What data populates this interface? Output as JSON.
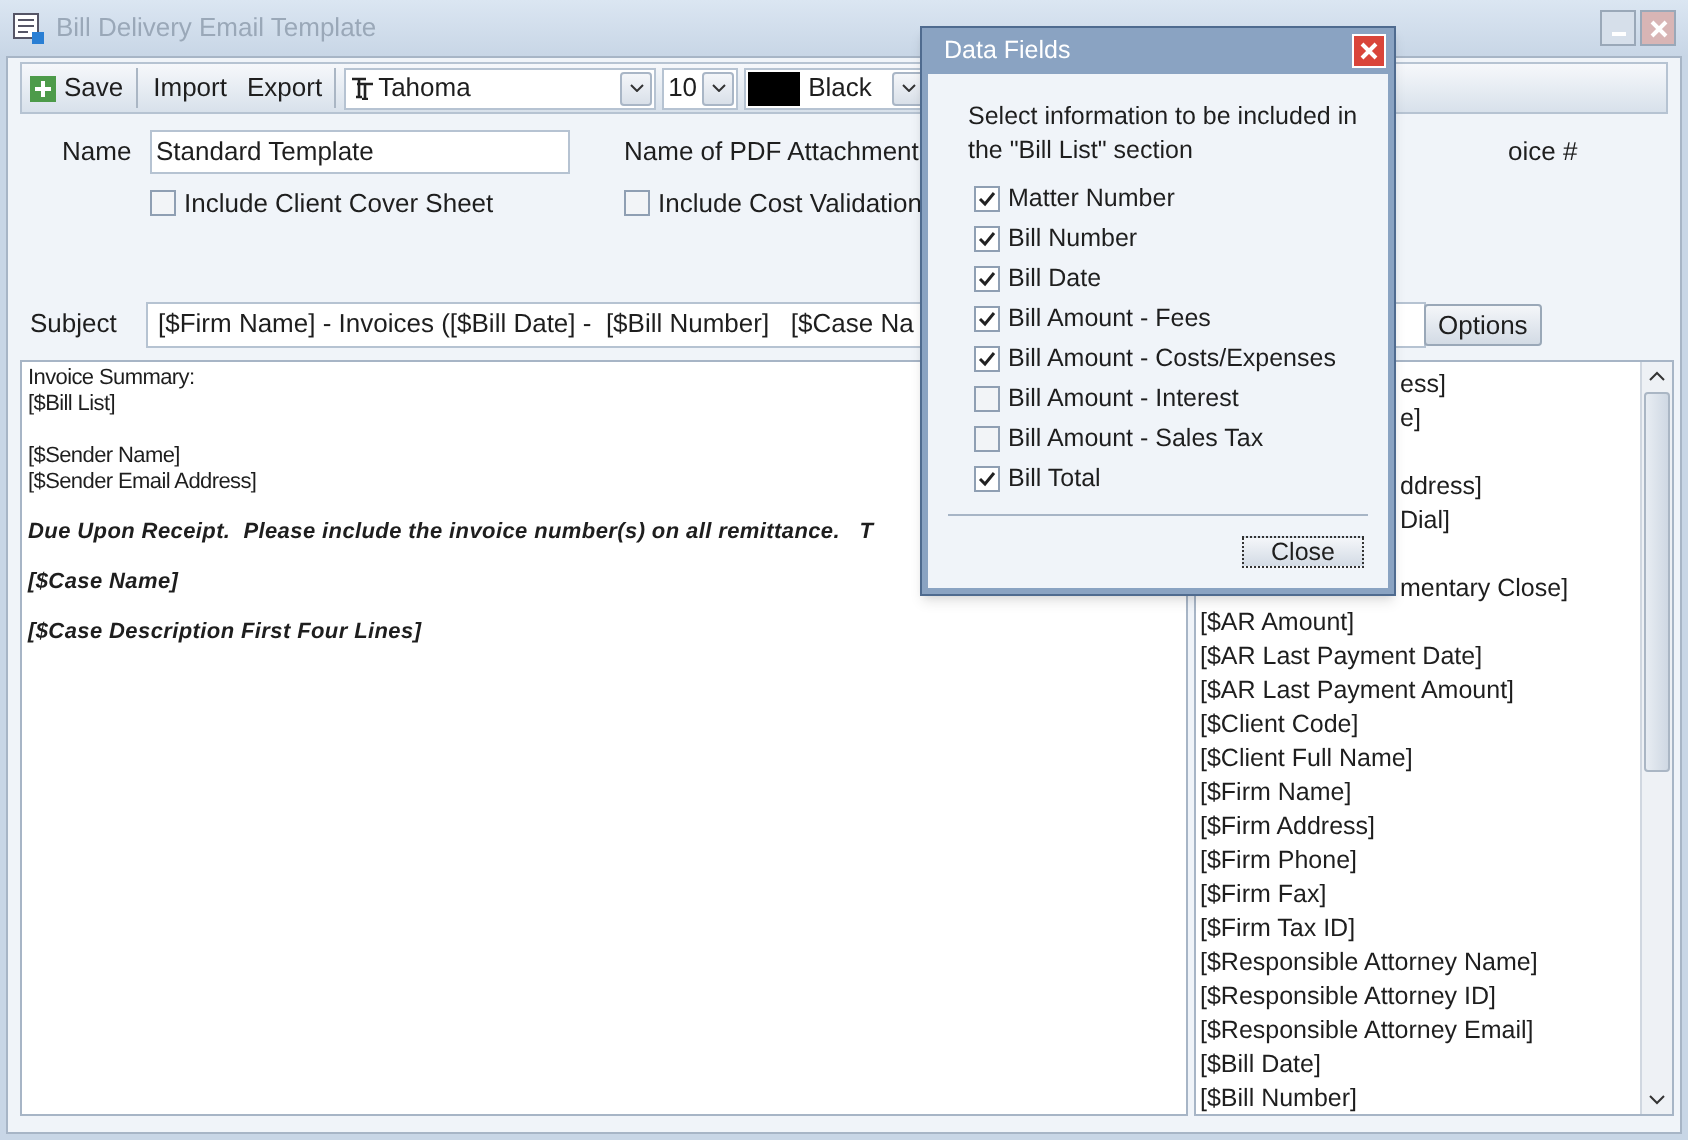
{
  "window": {
    "title": "Bill Delivery Email Template"
  },
  "toolbar": {
    "save": "Save",
    "import": "Import",
    "export": "Export",
    "font": "Tahoma",
    "size": "10",
    "color_name": "Black",
    "color": "#000000"
  },
  "form": {
    "name_label": "Name",
    "name_value": "Standard Template",
    "pdf_label": "Name of PDF Attachment",
    "invoice_label_fragment": "oice #",
    "checkboxes": [
      {
        "label": "Include Client Cover Sheet",
        "checked": false
      },
      {
        "label": "Include Cost Validation",
        "checked": false
      }
    ],
    "subject_label": "Subject",
    "subject_value": "[$Firm Name] - Invoices ([$Bill Date] -  [$Bill Number]   [$Case Na",
    "options_button": "Options"
  },
  "editor": {
    "lines": [
      {
        "kind": "plain",
        "text": "Invoice Summary:"
      },
      {
        "kind": "plain",
        "text": "[$Bill List]"
      },
      {
        "kind": "blank"
      },
      {
        "kind": "plain",
        "text": "[$Sender Name]"
      },
      {
        "kind": "plain",
        "text": "[$Sender Email Address]"
      },
      {
        "kind": "emphasis",
        "text": "Due Upon Receipt.  Please include the invoice number(s) on all remittance.   T"
      },
      {
        "kind": "emphasis",
        "text": "[$Case Name]"
      },
      {
        "kind": "emphasis",
        "text": "[$Case Description First Four Lines]"
      }
    ]
  },
  "field_list": {
    "items": [
      {
        "kind": "clipped",
        "text": "ess]"
      },
      {
        "kind": "clipped",
        "text": "e]"
      },
      {
        "kind": "covered"
      },
      {
        "kind": "clipped",
        "text": "ddress]"
      },
      {
        "kind": "clipped",
        "text": "Dial]"
      },
      {
        "kind": "covered"
      },
      {
        "kind": "clipped",
        "text": "mentary Close]"
      },
      {
        "kind": "full",
        "text": "[$AR Amount]"
      },
      {
        "kind": "full",
        "text": "[$AR Last Payment Date]"
      },
      {
        "kind": "full",
        "text": "[$AR Last Payment Amount]"
      },
      {
        "kind": "full",
        "text": "[$Client Code]"
      },
      {
        "kind": "full",
        "text": "[$Client Full Name]"
      },
      {
        "kind": "full",
        "text": "[$Firm Name]"
      },
      {
        "kind": "full",
        "text": "[$Firm Address]"
      },
      {
        "kind": "full",
        "text": "[$Firm Phone]"
      },
      {
        "kind": "full",
        "text": "[$Firm Fax]"
      },
      {
        "kind": "full",
        "text": "[$Firm Tax ID]"
      },
      {
        "kind": "full",
        "text": "[$Responsible Attorney Name]"
      },
      {
        "kind": "full",
        "text": "[$Responsible Attorney ID]"
      },
      {
        "kind": "full",
        "text": "[$Responsible Attorney Email]"
      },
      {
        "kind": "full",
        "text": "[$Bill Date]"
      },
      {
        "kind": "full",
        "text": "[$Bill Number]"
      }
    ]
  },
  "dialog": {
    "title": "Data Fields",
    "instructions": "Select information to be included in the \"Bill List\" section",
    "options": [
      {
        "label": "Matter Number",
        "checked": true
      },
      {
        "label": "Bill Number",
        "checked": true
      },
      {
        "label": "Bill Date",
        "checked": true
      },
      {
        "label": "Bill Amount - Fees",
        "checked": true
      },
      {
        "label": "Bill Amount - Costs/Expenses",
        "checked": true
      },
      {
        "label": "Bill Amount - Interest",
        "checked": false
      },
      {
        "label": "Bill Amount - Sales Tax",
        "checked": false
      },
      {
        "label": "Bill Total",
        "checked": true
      }
    ],
    "close_button": "Close"
  }
}
